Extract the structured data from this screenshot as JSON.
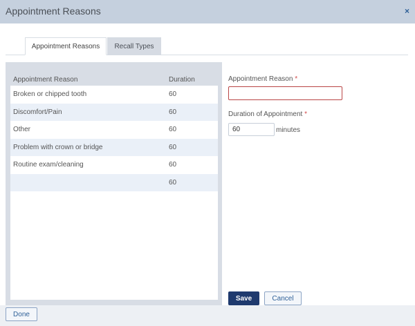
{
  "dialog": {
    "title": "Appointment Reasons",
    "close_symbol": "×"
  },
  "tabs": [
    {
      "label": "Appointment Reasons",
      "active": true
    },
    {
      "label": "Recall Types",
      "active": false
    }
  ],
  "table": {
    "headers": {
      "reason": "Appointment Reason",
      "duration": "Duration"
    },
    "rows": [
      {
        "reason": "Broken or chipped tooth",
        "duration": "60"
      },
      {
        "reason": "Discomfort/Pain",
        "duration": "60"
      },
      {
        "reason": "Other",
        "duration": "60"
      },
      {
        "reason": "Problem with crown or bridge",
        "duration": "60"
      },
      {
        "reason": "Routine exam/cleaning",
        "duration": "60"
      },
      {
        "reason": "",
        "duration": "60"
      }
    ]
  },
  "form": {
    "reason_label": "Appointment Reason",
    "reason_value": "",
    "duration_label": "Duration of Appointment",
    "required_mark": "*",
    "duration_value": "60",
    "minutes_label": "minutes"
  },
  "buttons": {
    "save": "Save",
    "cancel": "Cancel",
    "done": "Done"
  },
  "colors": {
    "titlebar": "#c5d0de",
    "primary": "#1f3a6e",
    "link": "#2d5f97",
    "required": "#d24a4a",
    "error_border": "#b94444",
    "row_alt": "#eaf0f8"
  }
}
